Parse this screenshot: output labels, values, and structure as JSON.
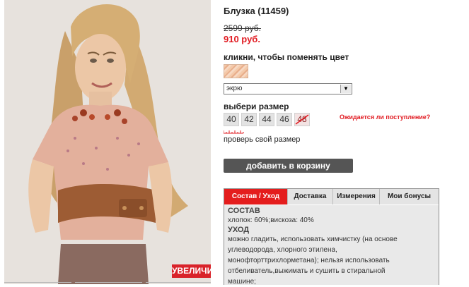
{
  "product": {
    "title": "Блузка (11459)",
    "old_price": "2599 руб.",
    "new_price": "910 руб.",
    "enlarge_label": "УВЕЛИЧИТЬ"
  },
  "color": {
    "label": "кликни, чтобы поменять цвет",
    "selected": "экрю"
  },
  "sizes": {
    "label": "выбери размер",
    "options": [
      "40",
      "42",
      "44",
      "46",
      "48"
    ],
    "unavailable_option": "48",
    "notify_label": "Ожидается ли поступление?",
    "check_size_label": "проверь свой размер"
  },
  "cart": {
    "button_label": "добавить в корзину"
  },
  "tabs": {
    "items": [
      "Состав / Уход",
      "Доставка",
      "Измерения",
      "Мои бонусы"
    ],
    "active": "Состав / Уход"
  },
  "composition": {
    "heading": "СОСТАВ",
    "text": "хлопок: 60%;вискоза: 40%",
    "care_heading": "УХОД",
    "care_lines": [
      "можно гладить, использовать химчистку (на основе",
      "углеводорода, хлорного этилена,",
      "монофторттрихлорметана); нельзя использовать",
      "отбеливатель,выжимать и сушить в стиральной",
      "машине;"
    ]
  },
  "colors": {
    "accent_red": "#e11b22",
    "tab_active": "#e41d1d",
    "cart_button": "#555555",
    "swatch": "#f0c2a1"
  }
}
